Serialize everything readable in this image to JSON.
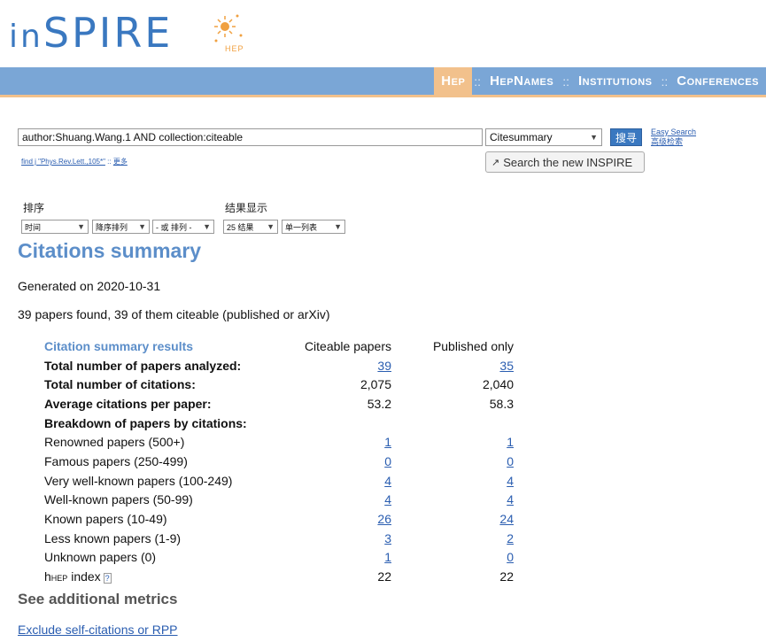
{
  "logo": {
    "text_in": "in",
    "text_spire": "SPIRE",
    "sub": "HEP"
  },
  "nav": {
    "items": [
      {
        "label": "Hep",
        "active": true
      },
      {
        "label": "HepNames",
        "active": false
      },
      {
        "label": "Institutions",
        "active": false
      },
      {
        "label": "Conferences",
        "active": false
      }
    ],
    "separator": "::"
  },
  "search": {
    "query": "author:Shuang.Wang.1 AND collection:citeable",
    "format": "Citesummary",
    "button": "搜寻",
    "easy_search": "Easy Search",
    "advanced": "高级检索",
    "new_inspire": "Search the new INSPIRE",
    "hint": "find j \"Phys.Rev.Lett.,105*\"",
    "hint_sep": "::",
    "more": "更多"
  },
  "sort": {
    "label": "排序",
    "field": "时间",
    "order": "降序排列",
    "or": "- 或 排列 -",
    "display_label": "结果显示",
    "per_page": "25 结果",
    "view": "单一列表"
  },
  "title": "Citations summary",
  "generated": "Generated on 2020-10-31",
  "found": "39 papers found, 39 of them citeable (published or arXiv)",
  "table": {
    "header": [
      "Citation summary results",
      "Citeable papers",
      "Published only"
    ],
    "rows": [
      {
        "label": "Total number of papers analyzed:",
        "bold": true,
        "a": "39",
        "b": "35",
        "link": true
      },
      {
        "label": "Total number of citations:",
        "bold": true,
        "a": "2,075",
        "b": "2,040",
        "link": false
      },
      {
        "label": "Average citations per paper:",
        "bold": true,
        "a": "53.2",
        "b": "58.3",
        "link": false
      },
      {
        "label": "Breakdown of papers by citations:",
        "bold": true,
        "a": "",
        "b": "",
        "link": false
      },
      {
        "label": "Renowned papers (500+)",
        "bold": false,
        "a": "1",
        "b": "1",
        "link": true
      },
      {
        "label": "Famous papers (250-499)",
        "bold": false,
        "a": "0",
        "b": "0",
        "link": true
      },
      {
        "label": "Very well-known papers (100-249)",
        "bold": false,
        "a": "4",
        "b": "4",
        "link": true
      },
      {
        "label": "Well-known papers (50-99)",
        "bold": false,
        "a": "4",
        "b": "4",
        "link": true
      },
      {
        "label": "Known papers (10-49)",
        "bold": false,
        "a": "26",
        "b": "24",
        "link": true
      },
      {
        "label": "Less known papers (1-9)",
        "bold": false,
        "a": "3",
        "b": "2",
        "link": true
      },
      {
        "label": "Unknown papers (0)",
        "bold": false,
        "a": "1",
        "b": "0",
        "link": true
      }
    ],
    "hindex": {
      "h": "h",
      "sub": "HEP",
      "rest": " index",
      "help": "?",
      "a": "22",
      "b": "22"
    }
  },
  "additional": "See additional metrics",
  "exclude": "Exclude self-citations or RPP"
}
